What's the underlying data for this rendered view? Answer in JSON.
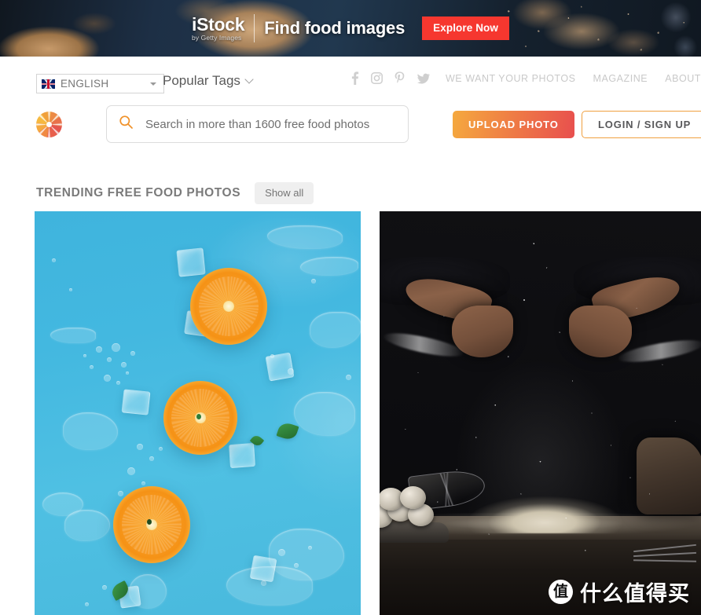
{
  "banner": {
    "brand": "iStock",
    "brand_sub": "by Getty Images",
    "headline": "Find food images",
    "cta_label": "Explore Now",
    "cta_color": "#f6372f"
  },
  "utility_nav": {
    "language": {
      "label": "ENGLISH",
      "flag_icon": "uk-flag-icon",
      "caret_icon": "caret-down-icon"
    },
    "popular_tags": {
      "label": "Popular Tags",
      "chevron_icon": "chevron-down-icon"
    },
    "social": [
      {
        "name": "facebook-icon",
        "glyph": "f"
      },
      {
        "name": "instagram-icon",
        "glyph": "▣"
      },
      {
        "name": "pinterest-icon",
        "glyph": "P"
      },
      {
        "name": "twitter-icon",
        "glyph": "ᵗ"
      }
    ],
    "links": [
      {
        "label": "WE WANT YOUR PHOTOS"
      },
      {
        "label": "MAGAZINE"
      },
      {
        "label": "ABOUT"
      }
    ]
  },
  "header": {
    "logo_icon": "aperture-logo-icon",
    "search": {
      "icon": "search-icon",
      "placeholder": "Search in more than 1600 free food photos",
      "value": ""
    },
    "upload_label": "UPLOAD PHOTO",
    "login_label": "LOGIN / SIGN UP",
    "accent_start": "#f5a93e",
    "accent_end": "#e84f4e"
  },
  "section": {
    "title": "TRENDING FREE FOOD PHOTOS",
    "show_all_label": "Show all"
  },
  "photos": [
    {
      "name": "photo-card-oranges",
      "subject": "orange slices on blue background with ice cubes and water droplets"
    },
    {
      "name": "photo-card-flour-hands",
      "subject": "hands dusting flour over dark wooden table with eggs and whisk"
    }
  ],
  "watermark": {
    "badge_glyph": "值",
    "text": "什么值得买"
  }
}
